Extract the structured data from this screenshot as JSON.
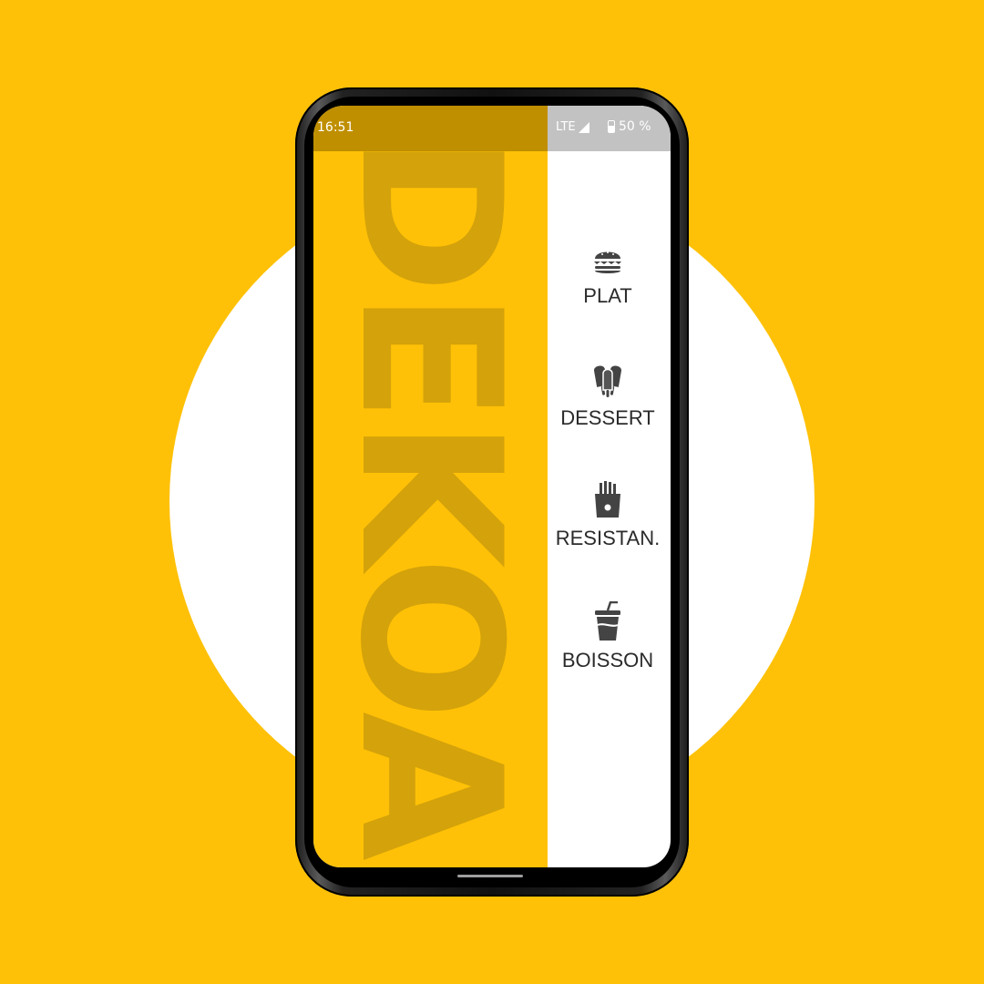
{
  "app": {
    "brand": "DEKOA"
  },
  "status": {
    "time": "16:51",
    "network": "LTE",
    "battery": "50 %"
  },
  "menu": {
    "items": [
      {
        "label": "PLAT",
        "icon": "burger-icon"
      },
      {
        "label": "DESSERT",
        "icon": "ice-cream-icon"
      },
      {
        "label": "RESISTAN.",
        "icon": "fries-icon"
      },
      {
        "label": "BOISSON",
        "icon": "drink-icon"
      }
    ]
  },
  "colors": {
    "background": "#FFC107",
    "panel": "#FFC107",
    "brand_text": "#D4A20A",
    "icon": "#444444",
    "label": "#2B2B2B"
  }
}
